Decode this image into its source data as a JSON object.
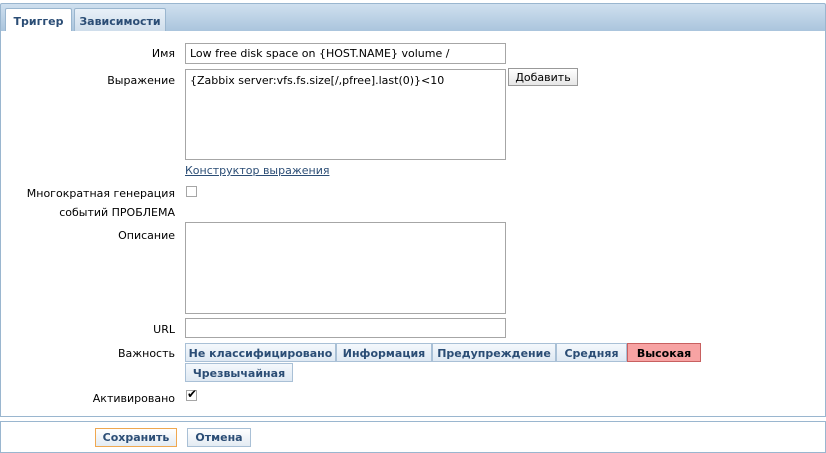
{
  "tabs": [
    {
      "label": "Триггер",
      "active": true
    },
    {
      "label": "Зависимости",
      "active": false
    }
  ],
  "form": {
    "name_label": "Имя",
    "name_value": "Low free disk space on {HOST.NAME} volume /",
    "expression_label": "Выражение",
    "expression_value": "{Zabbix server:vfs.fs.size[/,pfree].last(0)}<10",
    "add_button": "Добавить",
    "expression_constructor_link": "Конструктор выражения",
    "multiple_gen_label_line1": "Многократная генерация",
    "multiple_gen_label_line2": "событий ПРОБЛЕМА",
    "multiple_gen_checked": false,
    "description_label": "Описание",
    "description_value": "",
    "url_label": "URL",
    "url_value": "",
    "severity_label": "Важность",
    "severities": [
      "Не классифицировано",
      "Информация",
      "Предупреждение",
      "Средняя",
      "Высокая",
      "Чрезвычайная"
    ],
    "selected_severity": "Высокая",
    "enabled_label": "Активировано",
    "enabled_checked": true
  },
  "footer": {
    "save_button": "Сохранить",
    "cancel_button": "Отмена"
  },
  "colors": {
    "accent": "#2b4d75",
    "tab_bar": "#a9c4dc",
    "selected_severity": "#f7a3a3",
    "save_border": "#f0a850"
  }
}
